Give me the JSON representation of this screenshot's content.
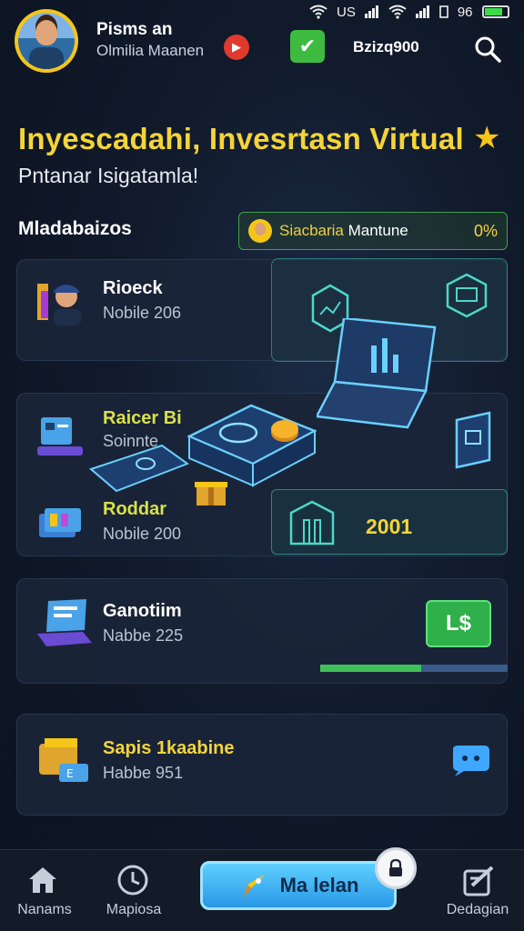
{
  "status_bar": {
    "carrier": "US",
    "battery": "96"
  },
  "header": {
    "user_name": "Pisms an",
    "user_subtitle": "Olmilia Maanen",
    "balance": "Bzizq900"
  },
  "hero": {
    "title": "Inyescadahi, Invesrtasn Virtual",
    "subtitle": "Pntanar Isigatamla!"
  },
  "section": {
    "label": "Mladabaizos",
    "chip_name": "Siacbaria",
    "chip_name_suffix": "Mantune",
    "chip_percent": "0%"
  },
  "cards": [
    {
      "title": "Rioeck",
      "subtitle": "Nobile 206",
      "title_color": "#ffffff"
    },
    {
      "title": "Raicer Bi",
      "subtitle": "Soinnte",
      "title_color": "#d9e04a"
    },
    {
      "title": "Roddar",
      "subtitle": "Nobile 200",
      "title_color": "#d9e04a"
    },
    {
      "title": "Ganotiim",
      "subtitle": "Nabbe 225",
      "title_color": "#ffffff"
    },
    {
      "title": "Sapis 1kaabine",
      "subtitle": "Habbe 951",
      "title_color": "#f5d43a"
    }
  ],
  "illustration": {
    "year": "2001"
  },
  "payment_button": {
    "label": "L$"
  },
  "progress": {
    "fraction": 0.54
  },
  "bottom_nav": {
    "home_label": "Nanams",
    "history_label": "Mapiosa",
    "cta_label": "Ma lelan",
    "profile_label": "Dedagian"
  }
}
